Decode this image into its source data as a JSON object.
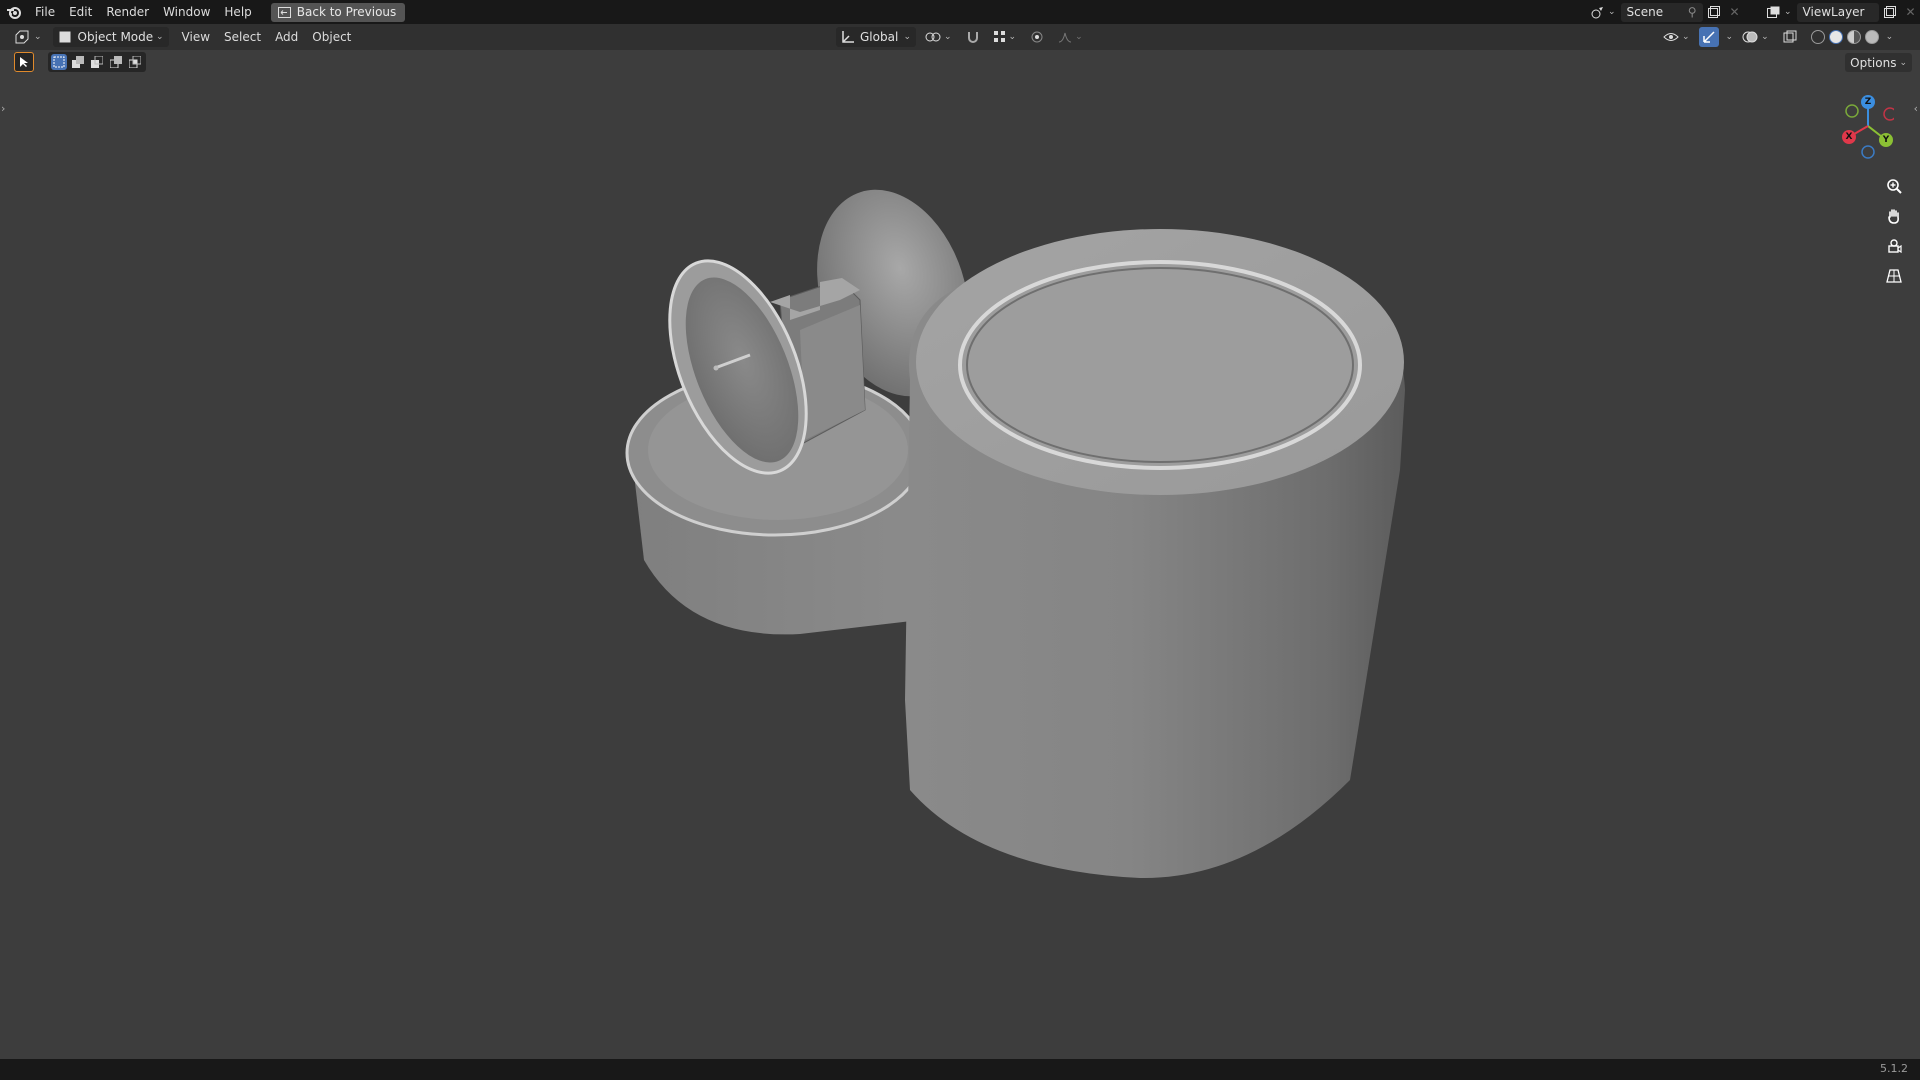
{
  "topbar": {
    "menus": [
      "File",
      "Edit",
      "Render",
      "Window",
      "Help"
    ],
    "back_button": "Back to Previous",
    "scene": "Scene",
    "view_layer": "ViewLayer"
  },
  "header": {
    "mode": "Object Mode",
    "menus": [
      "View",
      "Select",
      "Add",
      "Object"
    ],
    "orientation": "Global",
    "options": "Options"
  },
  "gizmo": {
    "z": "Z",
    "y": "Y",
    "x": "X"
  },
  "status": {
    "version": "5.1.2"
  },
  "colors": {
    "x_axis": "#e0384a",
    "y_axis": "#8bc034",
    "z_axis": "#3b8ee0",
    "background": "#3d3d3d"
  }
}
